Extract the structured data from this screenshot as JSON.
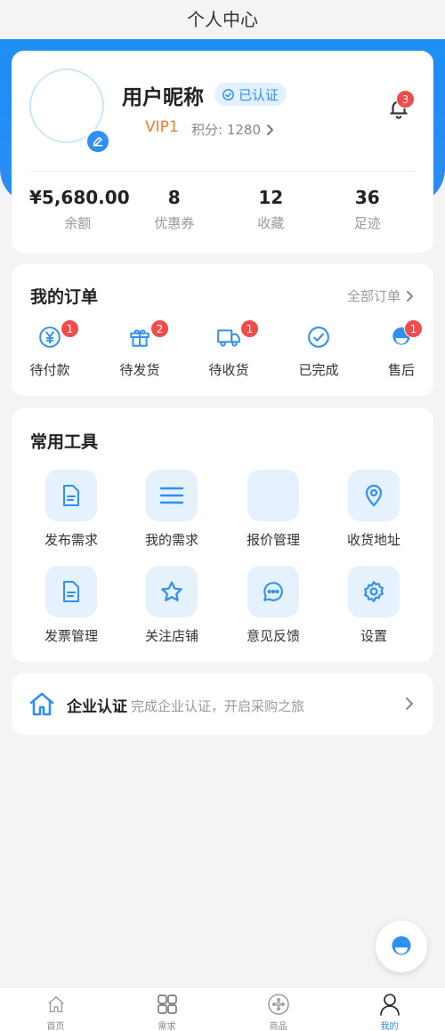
{
  "header": {
    "title": "个人中心"
  },
  "profile": {
    "nickname": "用户昵称",
    "verified": "已认证",
    "vip": "VIP1",
    "points": "积分: 1280",
    "notification_count": "3"
  },
  "stats": [
    {
      "value": "¥5,680.00",
      "label": "余额"
    },
    {
      "value": "8",
      "label": "优惠券"
    },
    {
      "value": "12",
      "label": "收藏"
    },
    {
      "value": "36",
      "label": "足迹"
    }
  ],
  "orders": {
    "title": "我的订单",
    "all_label": "全部订单",
    "items": [
      {
        "label": "待付款",
        "badge": "1",
        "icon": "yuan-coin-icon"
      },
      {
        "label": "待发货",
        "badge": "2",
        "icon": "gift-icon"
      },
      {
        "label": "待收货",
        "badge": "1",
        "icon": "truck-icon"
      },
      {
        "label": "已完成",
        "badge": "",
        "icon": "check-circle-icon"
      },
      {
        "label": "售后",
        "badge": "1",
        "icon": "customer-service-icon"
      }
    ]
  },
  "tools": {
    "title": "常用工具",
    "items": [
      {
        "label": "发布需求",
        "icon": "document-icon"
      },
      {
        "label": "我的需求",
        "icon": "list-icon"
      },
      {
        "label": "报价管理",
        "icon": "blank-icon"
      },
      {
        "label": "收货地址",
        "icon": "location-pin-icon"
      },
      {
        "label": "发票管理",
        "icon": "invoice-icon"
      },
      {
        "label": "关注店铺",
        "icon": "star-icon"
      },
      {
        "label": "意见反馈",
        "icon": "chat-bubble-icon"
      },
      {
        "label": "设置",
        "icon": "gear-icon"
      }
    ]
  },
  "enterprise": {
    "title": "企业认证",
    "description": "完成企业认证，开启采购之旅"
  },
  "tabbar": [
    {
      "label": "首页",
      "icon": "home-icon",
      "active": false
    },
    {
      "label": "需求",
      "icon": "grid-icon",
      "active": false
    },
    {
      "label": "商品",
      "icon": "product-icon",
      "active": false
    },
    {
      "label": "我的",
      "icon": "user-icon",
      "active": true
    }
  ],
  "colors": {
    "primary": "#2f8ff2",
    "badge": "#f24b4b",
    "vip": "#f07c2a"
  }
}
